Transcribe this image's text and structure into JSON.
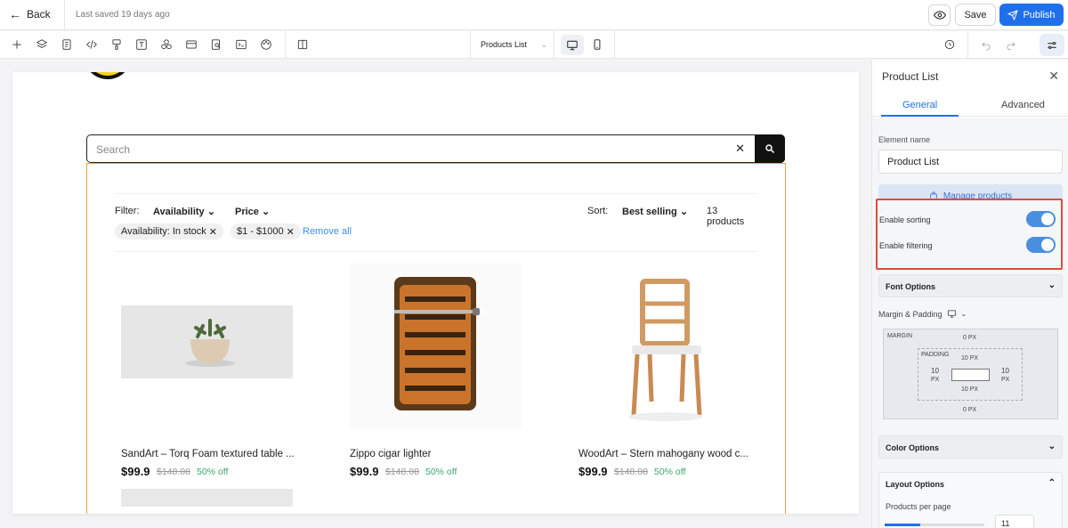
{
  "topbar": {
    "back_label": "Back",
    "last_saved": "Last saved 19 days ago",
    "save_label": "Save",
    "publish_label": "Publish"
  },
  "toolbar": {
    "page_select_value": "Products List",
    "icons": [
      "plus-icon",
      "layers-icon",
      "page-icon",
      "code-icon",
      "paint-icon",
      "text-icon",
      "components-icon",
      "section-icon",
      "seo-icon",
      "terminal-icon",
      "palette-icon",
      "split-view-icon"
    ]
  },
  "canvas": {
    "search_placeholder": "Search",
    "filter": {
      "filter_label": "Filter:",
      "availability": "Availability",
      "price": "Price",
      "sort_label": "Sort:",
      "sort_value": "Best selling",
      "count": "13 products",
      "chips": [
        "Availability: In stock",
        "$1 - $1000"
      ],
      "remove_all": "Remove all"
    },
    "products": [
      {
        "name": "SandArt – Torq Foam textured table ...",
        "price": "$99.9",
        "old_price": "$148.08",
        "discount": "50% off"
      },
      {
        "name": "Zippo cigar lighter",
        "price": "$99.9",
        "old_price": "$148.08",
        "discount": "50% off"
      },
      {
        "name": "WoodArt – Stern mahogany wood c...",
        "price": "$99.9",
        "old_price": "$148.08",
        "discount": "50% off"
      }
    ]
  },
  "panel": {
    "title": "Product List",
    "tabs": [
      "General",
      "Advanced"
    ],
    "element_name_label": "Element name",
    "element_name_value": "Product List",
    "manage_products": "Manage products",
    "enable_sorting": "Enable sorting",
    "enable_filtering": "Enable filtering",
    "font_options": "Font Options",
    "margin_padding": "Margin & Padding",
    "box": {
      "margin_label": "MARGIN",
      "padding_label": "PADDING",
      "margin_top": "0 PX",
      "margin_bottom": "0 PX",
      "padding_top": "10 PX",
      "padding_bottom": "10 PX",
      "padding_left": "10",
      "padding_left_unit": "PX",
      "padding_right": "10",
      "padding_right_unit": "PX"
    },
    "color_options": "Color Options",
    "layout_options": "Layout Options",
    "products_per_page_label": "Products per page",
    "products_per_page_value": "11"
  },
  "colors": {
    "accent": "#1f6feb",
    "highlight_border": "#e04b3c",
    "discount": "#3aa76d",
    "frame": "#f0a040"
  }
}
